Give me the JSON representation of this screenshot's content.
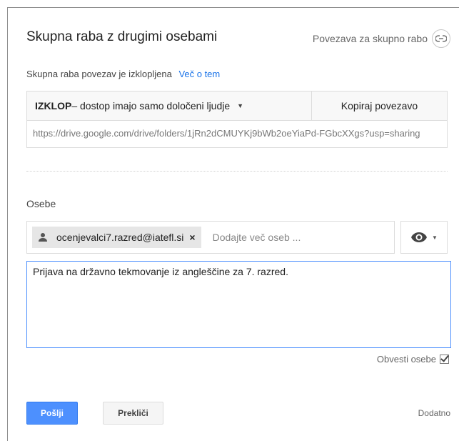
{
  "dialog": {
    "title": "Skupna raba z drugimi osebami",
    "link_share_label": "Povezava za skupno rabo"
  },
  "link_status": {
    "text": "Skupna raba povezav je izklopljena",
    "more_link": "Več o tem"
  },
  "access": {
    "mode_bold": "IZKLOP",
    "mode_rest": " – dostop imajo samo določeni ljudje",
    "copy_label": "Kopiraj povezavo",
    "url": "https://drive.google.com/drive/folders/1jRn2dCMUYKj9bWb2oeYiaPd-FGbcXXgs?usp=sharing"
  },
  "people": {
    "label": "Osebe",
    "chip_email": "ocenjevalci7.razred@iatefl.si",
    "chip_close": "×",
    "add_placeholder": "Dodajte več oseb ...",
    "permission_icon": "eye-icon"
  },
  "message": {
    "value": "Prijava na državno tekmovanje iz angleščine za 7. razred."
  },
  "notify": {
    "label": "Obvesti osebe",
    "checked": true
  },
  "actions": {
    "send_label": "Pošlji",
    "cancel_label": "Prekliči",
    "advanced_label": "Dodatno"
  },
  "colors": {
    "accent": "#4d90fe",
    "link": "#1a73e8",
    "border": "#dcdcdc"
  }
}
